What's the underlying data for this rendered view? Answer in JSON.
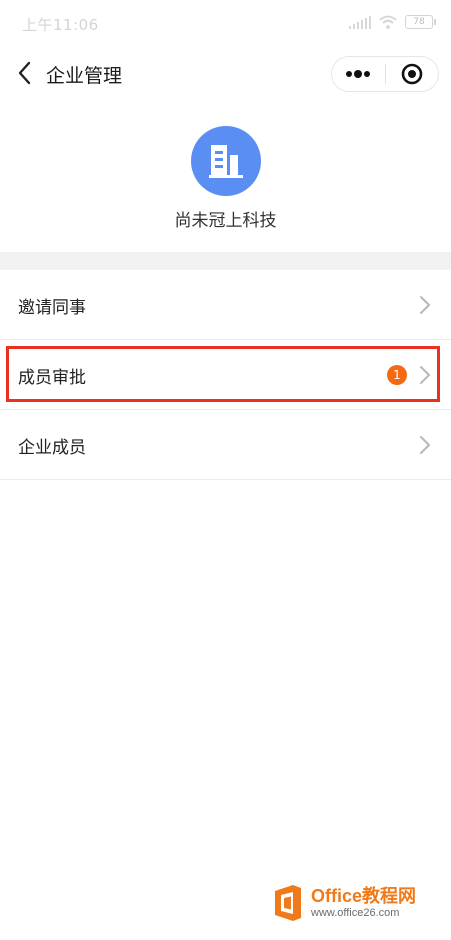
{
  "status_bar": {
    "time": "上午11:06",
    "battery": "78"
  },
  "nav": {
    "title": "企业管理",
    "back_icon": "chevron-left-icon",
    "more_icon": "more-dots-icon",
    "close_icon": "target-circle-icon"
  },
  "company": {
    "name": "尚未冠上科技",
    "logo_icon": "building-icon"
  },
  "menu": {
    "items": [
      {
        "label": "邀请同事"
      },
      {
        "label": "成员审批",
        "badge": "1"
      },
      {
        "label": "企业成员"
      }
    ]
  },
  "watermark": {
    "title": "Office教程网",
    "url": "www.office26.com"
  },
  "colors": {
    "logo_bg": "#5b8ef2",
    "badge": "#f46a12",
    "highlight": "#e8321f",
    "watermark_brand": "#f07a1a"
  }
}
